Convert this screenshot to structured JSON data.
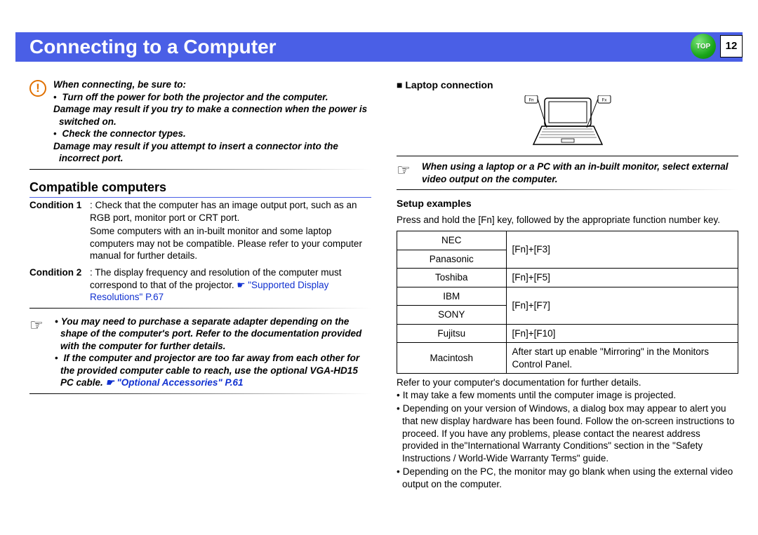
{
  "page": {
    "title": "Connecting to a Computer",
    "top_label": "TOP",
    "number": "12"
  },
  "caution": {
    "heading": "When connecting, be sure to:",
    "b1": "Turn off the power for both the projector and the computer.",
    "b1_cont": "Damage may result if you try to make a connection when the power is switched on.",
    "b2": "Check the connector types.",
    "b2_cont": "Damage may result if you attempt to insert a connector into the incorrect port."
  },
  "compat": {
    "heading": "Compatible computers",
    "cond1_label": "Condition 1",
    "cond1_a": ": Check that the computer has an image output port, such as an RGB port, monitor port or CRT port.",
    "cond1_b": "Some computers with an in-built monitor and some laptop computers may not be compatible. Please refer to your computer manual for further details.",
    "cond2_label": "Condition 2",
    "cond2_a": ": The display frequency and resolution of the computer must correspond to that of the projector. ",
    "cond2_link": "\"Supported Display Resolutions\" P.67"
  },
  "tip1": {
    "b1": "You may need to purchase a separate adapter depending on the shape of the computer's port. Refer to the documentation provided with the computer for further details.",
    "b2": "If the computer and projector are too far away from each other for the provided computer cable to reach, use the optional VGA-HD15 PC cable. ",
    "b2_link": "\"Optional Accessories\" P.61"
  },
  "laptop": {
    "heading": "Laptop connection",
    "key_left": "Fn",
    "key_right": "Fx"
  },
  "tip2": {
    "text": "When using a laptop or a PC with an in-built monitor, select external video output on the computer."
  },
  "setup": {
    "heading": "Setup examples",
    "intro": "Press and hold the [Fn] key, followed by the appropriate function number key.",
    "rows": [
      {
        "brand": "NEC",
        "key": "[Fn]+[F3]"
      },
      {
        "brand": "Panasonic",
        "key": ""
      },
      {
        "brand": "Toshiba",
        "key": "[Fn]+[F5]"
      },
      {
        "brand": "IBM",
        "key": "[Fn]+[F7]"
      },
      {
        "brand": "SONY",
        "key": ""
      },
      {
        "brand": "Fujitsu",
        "key": "[Fn]+[F10]"
      },
      {
        "brand": "Macintosh",
        "key": "After start up enable \"Mirroring\" in the Monitors Control Panel."
      }
    ],
    "after": "Refer to your computer's documentation for further details.",
    "n1": "It may take a few moments until the computer image is projected.",
    "n2": "Depending on your version of Windows, a dialog box may appear to alert you that new display hardware has been found. Follow the on-screen instructions to proceed. If you have any problems, please contact the nearest address provided in the\"International Warranty Conditions\" section in the \"Safety Instructions / World-Wide Warranty Terms\" guide.",
    "n3": "Depending on the PC, the monitor may go blank when using the external video output on the computer."
  }
}
